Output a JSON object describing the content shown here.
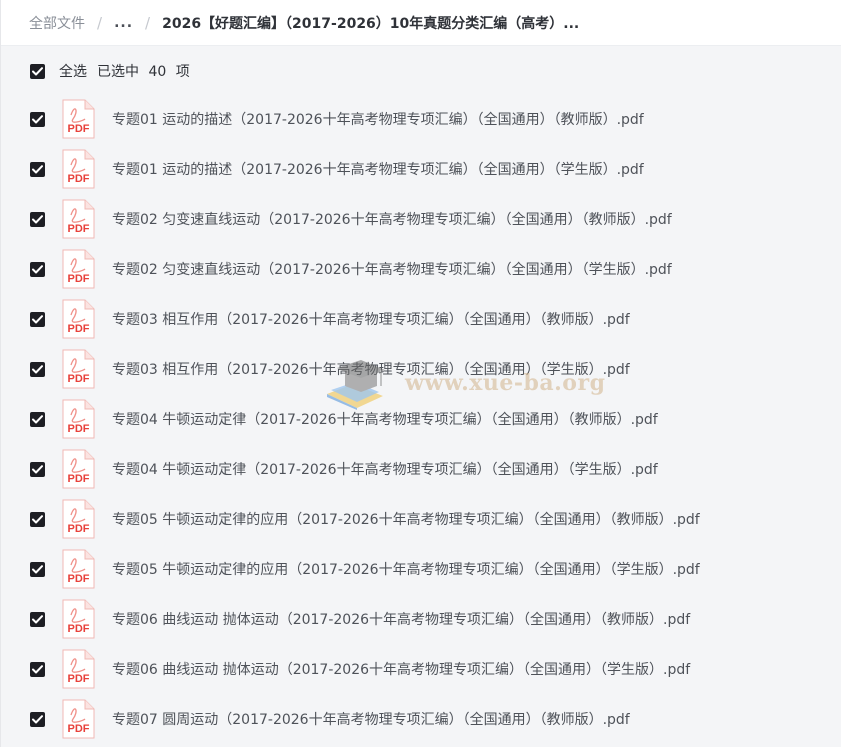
{
  "breadcrumb": {
    "root": "全部文件",
    "ellipsis": "...",
    "current": "2026【好题汇编】（2017-2026）10年真题分类汇编（高考）..."
  },
  "selection": {
    "select_all_label": "全选",
    "selected_text": "已选中 40 项"
  },
  "files": [
    {
      "name": "专题01 运动的描述（2017-2026十年高考物理专项汇编）（全国通用）（教师版）.pdf",
      "checked": true,
      "icon": "pdf-icon"
    },
    {
      "name": "专题01 运动的描述（2017-2026十年高考物理专项汇编）（全国通用）（学生版）.pdf",
      "checked": true,
      "icon": "pdf-icon"
    },
    {
      "name": "专题02 匀变速直线运动（2017-2026十年高考物理专项汇编）（全国通用）（教师版）.pdf",
      "checked": true,
      "icon": "pdf-icon"
    },
    {
      "name": "专题02 匀变速直线运动（2017-2026十年高考物理专项汇编）（全国通用）（学生版）.pdf",
      "checked": true,
      "icon": "pdf-icon"
    },
    {
      "name": "专题03 相互作用（2017-2026十年高考物理专项汇编）（全国通用）（教师版）.pdf",
      "checked": true,
      "icon": "pdf-icon"
    },
    {
      "name": "专题03 相互作用（2017-2026十年高考物理专项汇编）（全国通用）（学生版）.pdf",
      "checked": true,
      "icon": "pdf-icon"
    },
    {
      "name": "专题04 牛顿运动定律（2017-2026十年高考物理专项汇编）（全国通用）（教师版）.pdf",
      "checked": true,
      "icon": "pdf-icon"
    },
    {
      "name": "专题04 牛顿运动定律（2017-2026十年高考物理专项汇编）（全国通用）（学生版）.pdf",
      "checked": true,
      "icon": "pdf-icon"
    },
    {
      "name": "专题05 牛顿运动定律的应用（2017-2026十年高考物理专项汇编）（全国通用）（教师版）.pdf",
      "checked": true,
      "icon": "pdf-icon"
    },
    {
      "name": "专题05 牛顿运动定律的应用（2017-2026十年高考物理专项汇编）（全国通用）（学生版）.pdf",
      "checked": true,
      "icon": "pdf-icon"
    },
    {
      "name": "专题06 曲线运动 抛体运动（2017-2026十年高考物理专项汇编）（全国通用）（教师版）.pdf",
      "checked": true,
      "icon": "pdf-icon"
    },
    {
      "name": "专题06 曲线运动 抛体运动（2017-2026十年高考物理专项汇编）（全国通用）（学生版）.pdf",
      "checked": true,
      "icon": "pdf-icon"
    },
    {
      "name": "专题07 圆周运动（2017-2026十年高考物理专项汇编）（全国通用）（教师版）.pdf",
      "checked": true,
      "icon": "pdf-icon"
    }
  ],
  "watermark": {
    "text": "www.xue-ba.org"
  },
  "colors": {
    "checkbox": "#1d1e24",
    "pdf_red": "#e8403a",
    "text": "#4e5259",
    "background": "#f4f5f7"
  }
}
